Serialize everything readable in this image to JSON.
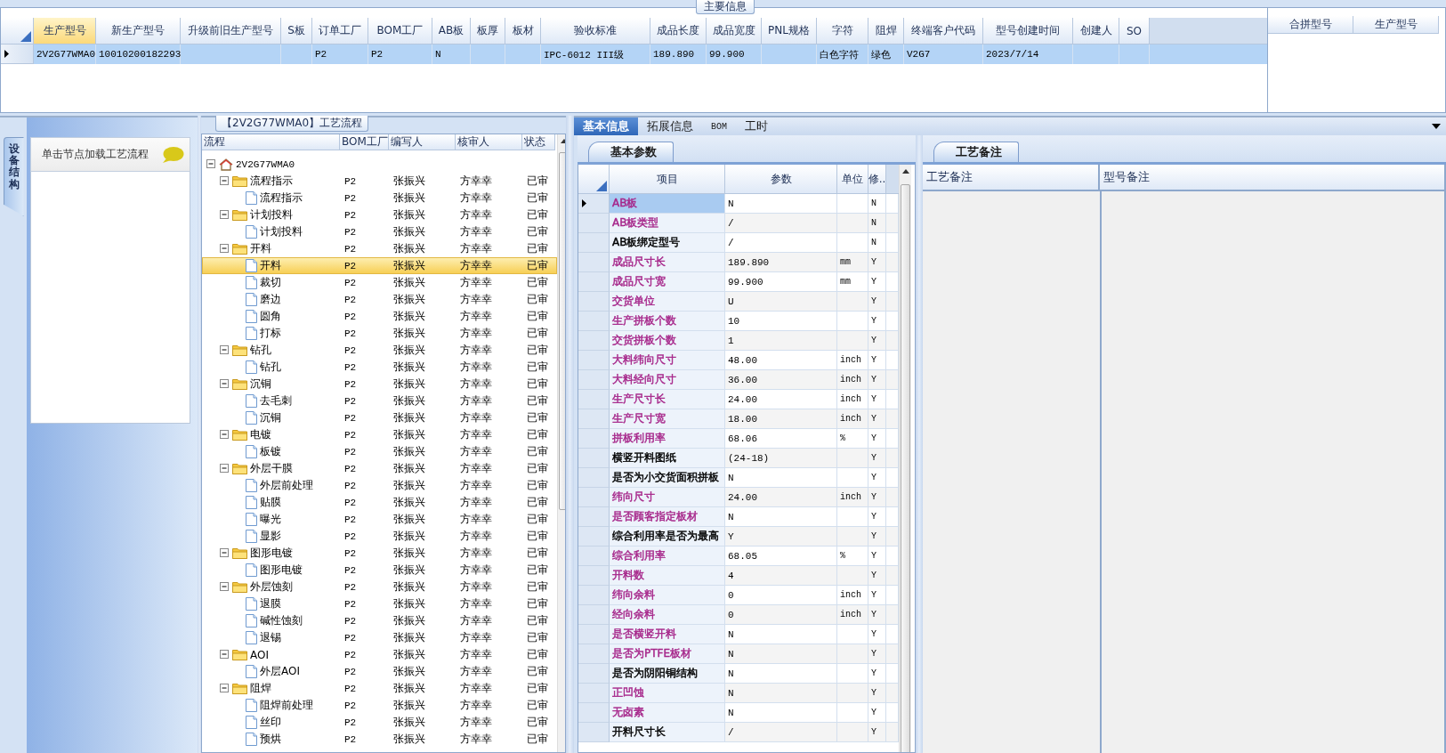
{
  "main_info": {
    "title": "主要信息",
    "columns": [
      {
        "label": "生产型号",
        "selected": true
      },
      {
        "label": "新生产型号",
        "selected": false
      },
      {
        "label": "升级前旧生产型号",
        "selected": false
      },
      {
        "label": "S板",
        "selected": false
      },
      {
        "label": "订单工厂",
        "selected": false
      },
      {
        "label": "BOM工厂",
        "selected": false
      },
      {
        "label": "AB板",
        "selected": false
      },
      {
        "label": "板厚",
        "selected": false
      },
      {
        "label": "板材",
        "selected": false
      },
      {
        "label": "验收标准",
        "selected": false
      },
      {
        "label": "成品长度",
        "selected": false
      },
      {
        "label": "成品宽度",
        "selected": false
      },
      {
        "label": "PNL规格",
        "selected": false
      },
      {
        "label": "字符",
        "selected": false
      },
      {
        "label": "阻焊",
        "selected": false
      },
      {
        "label": "终端客户代码",
        "selected": false
      },
      {
        "label": "型号创建时间",
        "selected": false
      },
      {
        "label": "创建人",
        "selected": false
      },
      {
        "label": "SO",
        "selected": false
      }
    ],
    "rows": [
      {
        "selected": true,
        "cells": [
          {
            "text": "2V2G77WMA0"
          },
          {
            "text": "10010200182293"
          },
          {},
          {},
          {
            "text": "P2"
          },
          {
            "text": "P2"
          },
          {
            "text": "N"
          },
          {},
          {},
          {
            "text": "IPC-6012 III级"
          },
          {
            "text": "189.890"
          },
          {
            "text": "99.900"
          },
          {},
          {
            "text": "白色字符"
          },
          {
            "text": "绿色"
          },
          {
            "text": "V2G7"
          },
          {
            "text": "2023/7/14"
          },
          {},
          {}
        ]
      }
    ]
  },
  "merge_panel": {
    "columns": [
      "合拼型号",
      "生产型号"
    ]
  },
  "left_panel": {
    "tab": {
      "label": "设备结构",
      "selected": true
    },
    "hint": "单击节点加载工艺流程"
  },
  "tree": {
    "title": "【2V2G77WMA0】工艺流程",
    "columns": [
      "流程",
      "BOM工厂",
      "编写人",
      "核审人",
      "状态"
    ],
    "nodes": [
      {
        "label": "2V2G77WMA0",
        "kind": "root",
        "expanded": true,
        "selected": false,
        "children": [
          {
            "label": "流程指示",
            "kind": "folder",
            "expanded": true,
            "selected": false,
            "bom": "P2",
            "writer": "张振兴",
            "reviewer": "方幸幸",
            "status": "已审",
            "children": [
              {
                "label": "流程指示",
                "kind": "step",
                "selected": false,
                "bom": "P2",
                "writer": "张振兴",
                "reviewer": "方幸幸",
                "status": "已审"
              }
            ]
          },
          {
            "label": "计划投料",
            "kind": "folder",
            "expanded": true,
            "selected": false,
            "bom": "P2",
            "writer": "张振兴",
            "reviewer": "方幸幸",
            "status": "已审",
            "children": [
              {
                "label": "计划投料",
                "kind": "step",
                "selected": false,
                "bom": "P2",
                "writer": "张振兴",
                "reviewer": "方幸幸",
                "status": "已审"
              }
            ]
          },
          {
            "label": "开料",
            "kind": "folder",
            "expanded": true,
            "selected": false,
            "bom": "P2",
            "writer": "张振兴",
            "reviewer": "方幸幸",
            "status": "已审",
            "children": [
              {
                "label": "开料",
                "kind": "step",
                "selected": true,
                "bom": "P2",
                "writer": "张振兴",
                "reviewer": "方幸幸",
                "status": "已审"
              },
              {
                "label": "裁切",
                "kind": "step",
                "selected": false,
                "bom": "P2",
                "writer": "张振兴",
                "reviewer": "方幸幸",
                "status": "已审"
              },
              {
                "label": "磨边",
                "kind": "step",
                "selected": false,
                "bom": "P2",
                "writer": "张振兴",
                "reviewer": "方幸幸",
                "status": "已审"
              },
              {
                "label": "圆角",
                "kind": "step",
                "selected": false,
                "bom": "P2",
                "writer": "张振兴",
                "reviewer": "方幸幸",
                "status": "已审"
              },
              {
                "label": "打标",
                "kind": "step",
                "selected": false,
                "bom": "P2",
                "writer": "张振兴",
                "reviewer": "方幸幸",
                "status": "已审"
              }
            ]
          },
          {
            "label": "钻孔",
            "kind": "folder",
            "expanded": true,
            "selected": false,
            "bom": "P2",
            "writer": "张振兴",
            "reviewer": "方幸幸",
            "status": "已审",
            "children": [
              {
                "label": "钻孔",
                "kind": "step",
                "selected": false,
                "bom": "P2",
                "writer": "张振兴",
                "reviewer": "方幸幸",
                "status": "已审"
              }
            ]
          },
          {
            "label": "沉铜",
            "kind": "folder",
            "expanded": true,
            "selected": false,
            "bom": "P2",
            "writer": "张振兴",
            "reviewer": "方幸幸",
            "status": "已审",
            "children": [
              {
                "label": "去毛刺",
                "kind": "step",
                "selected": false,
                "bom": "P2",
                "writer": "张振兴",
                "reviewer": "方幸幸",
                "status": "已审"
              },
              {
                "label": "沉铜",
                "kind": "step",
                "selected": false,
                "bom": "P2",
                "writer": "张振兴",
                "reviewer": "方幸幸",
                "status": "已审"
              }
            ]
          },
          {
            "label": "电镀",
            "kind": "folder",
            "expanded": true,
            "selected": false,
            "bom": "P2",
            "writer": "张振兴",
            "reviewer": "方幸幸",
            "status": "已审",
            "children": [
              {
                "label": "板镀",
                "kind": "step",
                "selected": false,
                "bom": "P2",
                "writer": "张振兴",
                "reviewer": "方幸幸",
                "status": "已审"
              }
            ]
          },
          {
            "label": "外层干膜",
            "kind": "folder",
            "expanded": true,
            "selected": false,
            "bom": "P2",
            "writer": "张振兴",
            "reviewer": "方幸幸",
            "status": "已审",
            "children": [
              {
                "label": "外层前处理",
                "kind": "step",
                "selected": false,
                "bom": "P2",
                "writer": "张振兴",
                "reviewer": "方幸幸",
                "status": "已审"
              },
              {
                "label": "贴膜",
                "kind": "step",
                "selected": false,
                "bom": "P2",
                "writer": "张振兴",
                "reviewer": "方幸幸",
                "status": "已审"
              },
              {
                "label": "曝光",
                "kind": "step",
                "selected": false,
                "bom": "P2",
                "writer": "张振兴",
                "reviewer": "方幸幸",
                "status": "已审"
              },
              {
                "label": "显影",
                "kind": "step",
                "selected": false,
                "bom": "P2",
                "writer": "张振兴",
                "reviewer": "方幸幸",
                "status": "已审"
              }
            ]
          },
          {
            "label": "图形电镀",
            "kind": "folder",
            "expanded": true,
            "selected": false,
            "bom": "P2",
            "writer": "张振兴",
            "reviewer": "方幸幸",
            "status": "已审",
            "children": [
              {
                "label": "图形电镀",
                "kind": "step",
                "selected": false,
                "bom": "P2",
                "writer": "张振兴",
                "reviewer": "方幸幸",
                "status": "已审"
              }
            ]
          },
          {
            "label": "外层蚀刻",
            "kind": "folder",
            "expanded": true,
            "selected": false,
            "bom": "P2",
            "writer": "张振兴",
            "reviewer": "方幸幸",
            "status": "已审",
            "children": [
              {
                "label": "退膜",
                "kind": "step",
                "selected": false,
                "bom": "P2",
                "writer": "张振兴",
                "reviewer": "方幸幸",
                "status": "已审"
              },
              {
                "label": "碱性蚀刻",
                "kind": "step",
                "selected": false,
                "bom": "P2",
                "writer": "张振兴",
                "reviewer": "方幸幸",
                "status": "已审"
              },
              {
                "label": "退锡",
                "kind": "step",
                "selected": false,
                "bom": "P2",
                "writer": "张振兴",
                "reviewer": "方幸幸",
                "status": "已审"
              }
            ]
          },
          {
            "label": "AOI",
            "kind": "folder",
            "expanded": true,
            "selected": false,
            "bom": "P2",
            "writer": "张振兴",
            "reviewer": "方幸幸",
            "status": "已审",
            "children": [
              {
                "label": "外层AOI",
                "kind": "step",
                "selected": false,
                "bom": "P2",
                "writer": "张振兴",
                "reviewer": "方幸幸",
                "status": "已审"
              }
            ]
          },
          {
            "label": "阻焊",
            "kind": "folder",
            "expanded": true,
            "selected": false,
            "bom": "P2",
            "writer": "张振兴",
            "reviewer": "方幸幸",
            "status": "已审",
            "children": [
              {
                "label": "阻焊前处理",
                "kind": "step",
                "selected": false,
                "bom": "P2",
                "writer": "张振兴",
                "reviewer": "方幸幸",
                "status": "已审"
              },
              {
                "label": "丝印",
                "kind": "step",
                "selected": false,
                "bom": "P2",
                "writer": "张振兴",
                "reviewer": "方幸幸",
                "status": "已审"
              },
              {
                "label": "预烘",
                "kind": "step",
                "selected": false,
                "bom": "P2",
                "writer": "张振兴",
                "reviewer": "方幸幸",
                "status": "已审"
              }
            ]
          }
        ]
      }
    ]
  },
  "details": {
    "tabs": [
      {
        "label": "基本信息",
        "selected": true
      },
      {
        "label": "拓展信息",
        "selected": false
      },
      {
        "label": "BOM",
        "selected": false
      },
      {
        "label": "工时",
        "selected": false
      }
    ],
    "params": {
      "tab": "基本参数",
      "columns": [
        "项目",
        "参数",
        "单位",
        "修.."
      ],
      "rows": [
        {
          "name": "AB板",
          "value": "N",
          "flag": "N",
          "color": "#a6268a",
          "selected": true
        },
        {
          "name": "AB板类型",
          "value": "/",
          "flag": "N",
          "color": "#a6268a",
          "selected": false
        },
        {
          "name": "AB板绑定型号",
          "value": "/",
          "flag": "N",
          "color": "#000000",
          "selected": false
        },
        {
          "name": "成品尺寸长",
          "value": "189.890",
          "unit": "mm",
          "flag": "Y",
          "color": "#a6268a",
          "selected": false
        },
        {
          "name": "成品尺寸宽",
          "value": "99.900",
          "unit": "mm",
          "flag": "Y",
          "color": "#a6268a",
          "selected": false
        },
        {
          "name": "交货单位",
          "value": "U",
          "flag": "Y",
          "color": "#a6268a",
          "selected": false
        },
        {
          "name": "生产拼板个数",
          "value": "10",
          "flag": "Y",
          "color": "#a6268a",
          "selected": false
        },
        {
          "name": "交货拼板个数",
          "value": "1",
          "flag": "Y",
          "color": "#a6268a",
          "selected": false
        },
        {
          "name": "大料纬向尺寸",
          "value": "48.00",
          "unit": "inch",
          "flag": "Y",
          "color": "#a6268a",
          "selected": false
        },
        {
          "name": "大料经向尺寸",
          "value": "36.00",
          "unit": "inch",
          "flag": "Y",
          "color": "#a6268a",
          "selected": false
        },
        {
          "name": "生产尺寸长",
          "value": "24.00",
          "unit": "inch",
          "flag": "Y",
          "color": "#a6268a",
          "selected": false
        },
        {
          "name": "生产尺寸宽",
          "value": "18.00",
          "unit": "inch",
          "flag": "Y",
          "color": "#a6268a",
          "selected": false
        },
        {
          "name": "拼板利用率",
          "value": "68.06",
          "unit": "%",
          "flag": "Y",
          "color": "#a6268a",
          "selected": false
        },
        {
          "name": "横竖开料图纸",
          "value": "(24-18)",
          "flag": "Y",
          "color": "#000000",
          "selected": false
        },
        {
          "name": "是否为小交货面积拼板",
          "value": "N",
          "flag": "Y",
          "color": "#000000",
          "selected": false
        },
        {
          "name": "纬向尺寸",
          "value": "24.00",
          "unit": "inch",
          "flag": "Y",
          "color": "#a6268a",
          "selected": false
        },
        {
          "name": "是否顾客指定板材",
          "value": "N",
          "flag": "Y",
          "color": "#a6268a",
          "selected": false
        },
        {
          "name": "综合利用率是否为最高",
          "value": "Y",
          "flag": "Y",
          "color": "#000000",
          "selected": false
        },
        {
          "name": "综合利用率",
          "value": "68.05",
          "unit": "%",
          "flag": "Y",
          "color": "#a6268a",
          "selected": false
        },
        {
          "name": "开料数",
          "value": "4",
          "flag": "Y",
          "color": "#a6268a",
          "selected": false
        },
        {
          "name": "纬向余料",
          "value": "0",
          "unit": "inch",
          "flag": "Y",
          "color": "#a6268a",
          "selected": false
        },
        {
          "name": "经向余料",
          "value": "0",
          "unit": "inch",
          "flag": "Y",
          "color": "#a6268a",
          "selected": false
        },
        {
          "name": "是否横竖开料",
          "value": "N",
          "flag": "Y",
          "color": "#a6268a",
          "selected": false
        },
        {
          "name": "是否为PTFE板材",
          "value": "N",
          "flag": "Y",
          "color": "#a6268a",
          "selected": false
        },
        {
          "name": "是否为阴阳铜结构",
          "value": "N",
          "flag": "Y",
          "color": "#000000",
          "selected": false
        },
        {
          "name": "正凹蚀",
          "value": "N",
          "flag": "Y",
          "color": "#a6268a",
          "selected": false
        },
        {
          "name": "无卤素",
          "value": "N",
          "flag": "Y",
          "color": "#a6268a",
          "selected": false
        },
        {
          "name": "开料尺寸长",
          "value": "/",
          "flag": "Y",
          "color": "#000000",
          "selected": false
        }
      ]
    },
    "remarks": {
      "tab": "工艺备注",
      "columns": [
        "工艺备注",
        "型号备注"
      ]
    }
  }
}
